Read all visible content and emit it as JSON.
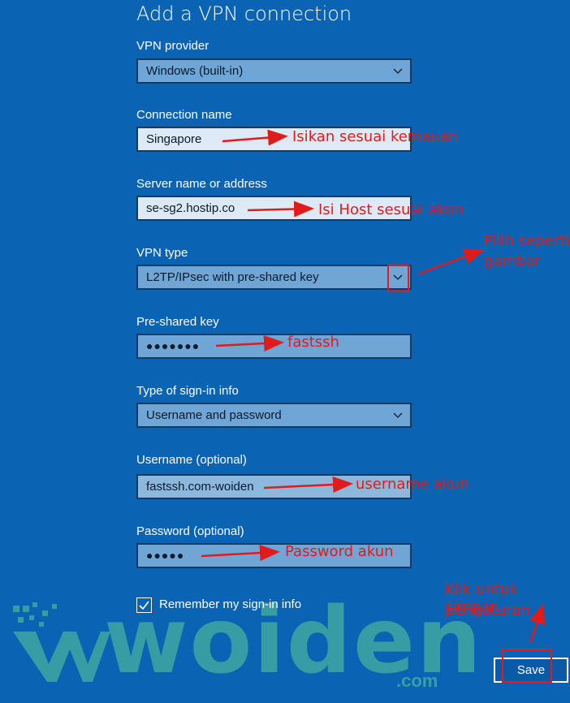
{
  "page": {
    "title": "Add a VPN connection"
  },
  "form": {
    "vpn_provider": {
      "label": "VPN provider",
      "value": "Windows (built-in)"
    },
    "connection_name": {
      "label": "Connection name",
      "value": "Singapore"
    },
    "server": {
      "label": "Server name or address",
      "value": "se-sg2.hostip.co"
    },
    "vpn_type": {
      "label": "VPN type",
      "value": "L2TP/IPsec with pre-shared key"
    },
    "preshared_key": {
      "label": "Pre-shared key",
      "masked": "●●●●●●●"
    },
    "signin_type": {
      "label": "Type of sign-in info",
      "value": "Username and password"
    },
    "username": {
      "label": "Username (optional)",
      "value": "fastssh.com-woiden"
    },
    "password": {
      "label": "Password (optional)",
      "masked": "●●●●●"
    },
    "remember": {
      "label": "Remember my sign-in info",
      "checked": true
    },
    "save_label": "Save"
  },
  "annotations": {
    "connection_name": "Isikan sesuai kemauan",
    "server": "Isi Host sesuai akun",
    "vpn_type": [
      "Pilih seperti",
      "gambar"
    ],
    "preshared_key": "fastssh",
    "username": "username akun",
    "password": "Password akun",
    "save": [
      "Klik untuk simpan",
      "pengaturan"
    ]
  },
  "watermark": {
    "brand": "woiden",
    "suffix": ".com"
  },
  "colors": {
    "background": "#0b63b3",
    "annotation": "#e01b1b",
    "watermark": "#3fa6a1"
  },
  "icons": {
    "dropdown": "chevron-down-icon",
    "checkbox": "checkmark-icon"
  }
}
